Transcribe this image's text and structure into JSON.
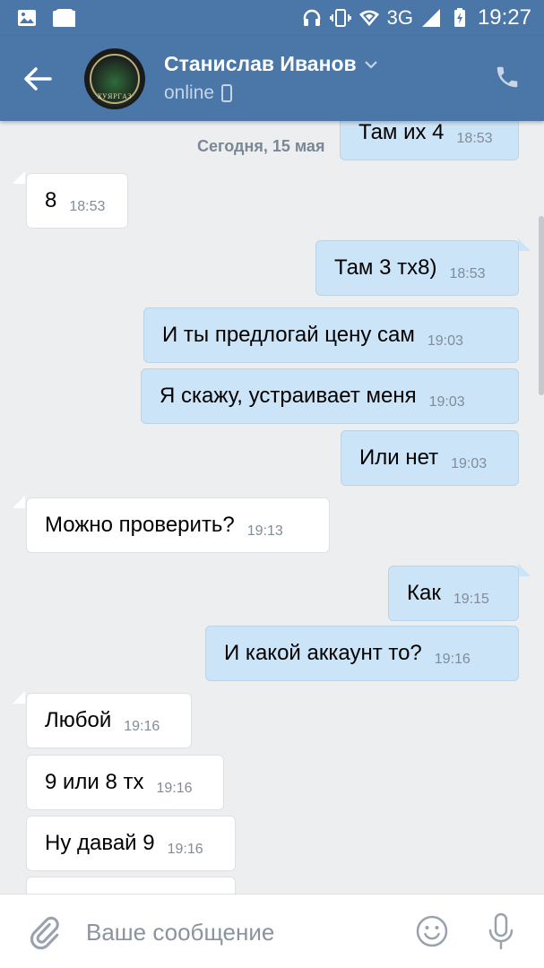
{
  "status_bar": {
    "time": "19:27",
    "network": "3G",
    "icons": [
      "gallery-icon",
      "message-icon",
      "headphones-icon",
      "vibrate-icon",
      "wifi-icon",
      "signal-icon",
      "battery-charging-icon"
    ]
  },
  "header": {
    "contact_name": "Станислав Иванов",
    "status": "online",
    "avatar_text": "ХУЯРГАЗ",
    "colors": {
      "bar": "#4a76a8",
      "status_text": "#c5d5e8"
    }
  },
  "chat": {
    "date_separator": "Сегодня, 15 мая",
    "messages": [
      {
        "dir": "out",
        "text": "Там их 4",
        "time": "18:53"
      },
      {
        "dir": "in",
        "text": "8",
        "time": "18:53"
      },
      {
        "dir": "out",
        "text": "Там 3 тх8)",
        "time": "18:53"
      },
      {
        "dir": "out",
        "text": "И ты предлогай цену сам",
        "time": "19:03"
      },
      {
        "dir": "out",
        "text": "Я скажу, устраивает меня",
        "time": "19:03"
      },
      {
        "dir": "out",
        "text": "Или нет",
        "time": "19:03"
      },
      {
        "dir": "in",
        "text": "Можно проверить?",
        "time": "19:13"
      },
      {
        "dir": "out",
        "text": "Как",
        "time": "19:15"
      },
      {
        "dir": "out",
        "text": "И какой аккаунт то?",
        "time": "19:16"
      },
      {
        "dir": "in",
        "text": "Любой",
        "time": "19:16"
      },
      {
        "dir": "in",
        "text": "9 или 8 тх",
        "time": "19:16"
      },
      {
        "dir": "in",
        "text": "Ну давай 9",
        "time": "19:16"
      },
      {
        "dir": "in",
        "text": "",
        "time": ""
      }
    ],
    "colors": {
      "outgoing": "#cce4f7",
      "incoming": "#ffffff",
      "background": "#edeef0"
    }
  },
  "composer": {
    "placeholder": "Ваше сообщение"
  }
}
